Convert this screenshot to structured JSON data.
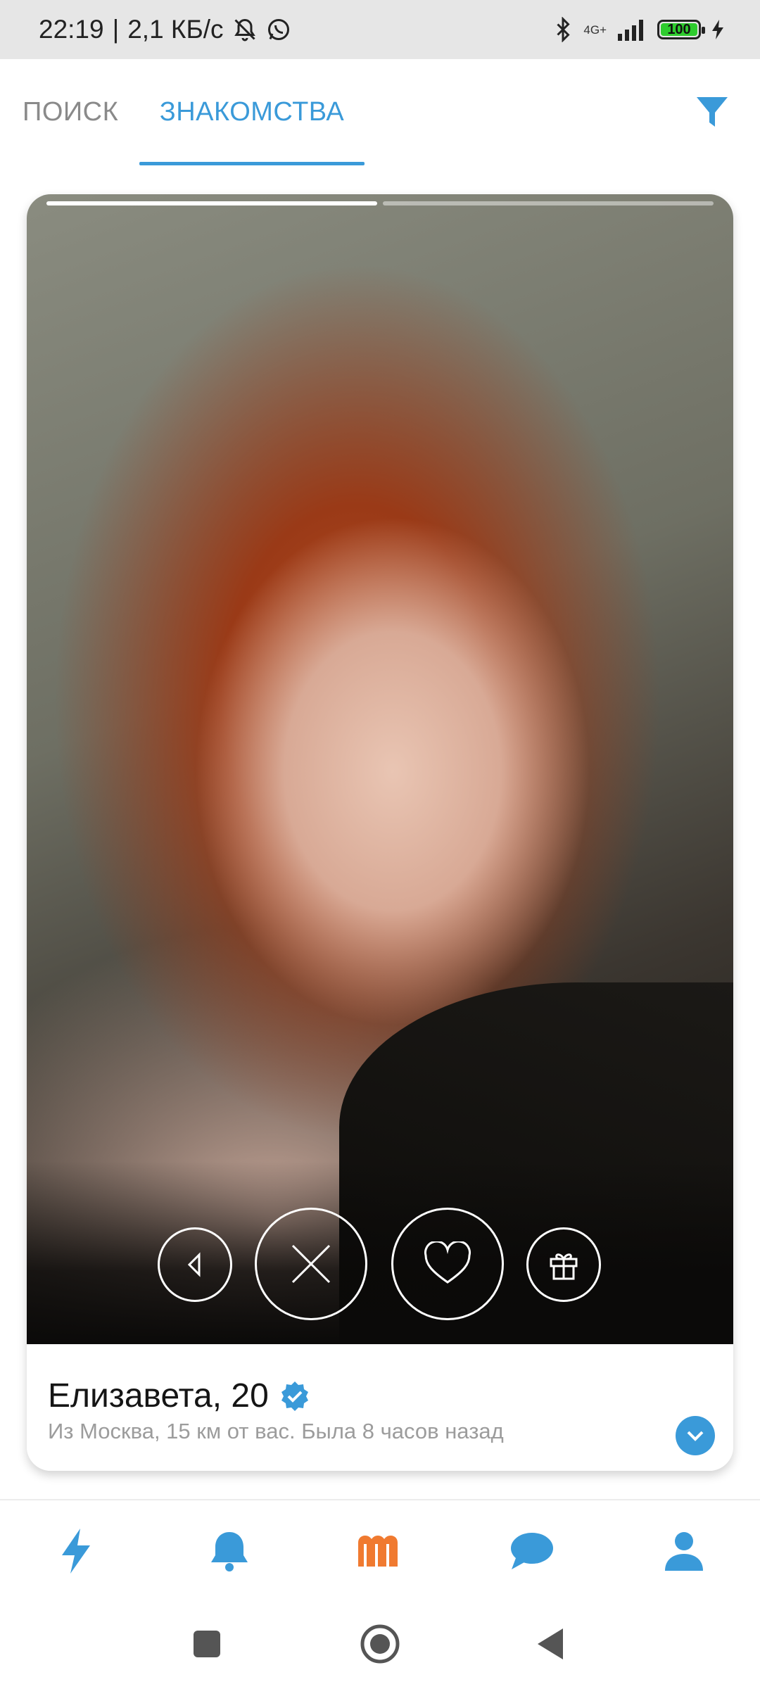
{
  "status_bar": {
    "time": "22:19",
    "separator": "|",
    "speed": "2,1 КБ/с",
    "network": "4G+",
    "battery": "100",
    "icons": [
      "bell-off-icon",
      "whatsapp-icon",
      "bluetooth-icon",
      "signal-icon",
      "battery-icon",
      "charging-icon"
    ]
  },
  "tabs": {
    "search": "ПОИСК",
    "dating": "ЗНАКОМСТВА",
    "active": "dating"
  },
  "card": {
    "photo_count": 2,
    "active_photo": 1,
    "name": "Елизавета, 20",
    "subtitle": "Из Москва, 15 км от вас. Была 8 часов назад",
    "verified": true,
    "actions": [
      "back-icon",
      "close-icon",
      "heart-icon",
      "gift-icon"
    ]
  },
  "bottom_nav": [
    "lightning-icon",
    "bell-icon",
    "m-logo-icon",
    "chat-icon",
    "profile-icon"
  ],
  "system_nav": [
    "recent-apps-icon",
    "home-icon",
    "back-icon"
  ],
  "colors": {
    "accent": "#3a9ad9",
    "brand_m": "#f07a30",
    "inactive_tab": "#8a8a8a",
    "status_bar_bg": "#e6e6e6",
    "battery_fill": "#2ecc2e"
  }
}
